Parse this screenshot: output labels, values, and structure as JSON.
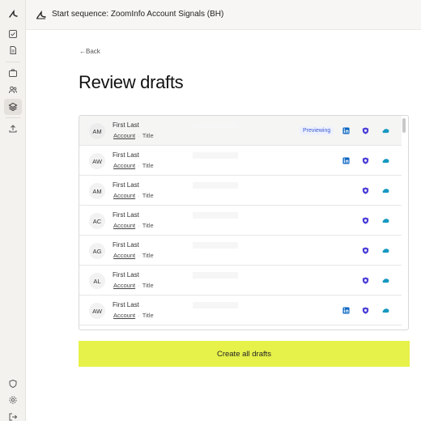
{
  "app": {
    "title": "Start sequence: ZoomInfo Account Signals (BH)"
  },
  "sidebar": {
    "items": [
      {
        "icon": "checkbox-icon"
      },
      {
        "icon": "document-icon"
      },
      {
        "icon": "briefcase-icon"
      },
      {
        "icon": "users-icon"
      },
      {
        "icon": "layers-icon",
        "active": true
      },
      {
        "icon": "upload-icon"
      }
    ],
    "bottom_items": [
      {
        "icon": "shield-icon"
      },
      {
        "icon": "gear-icon"
      },
      {
        "icon": "logout-icon"
      }
    ]
  },
  "nav": {
    "back_label": "←Back"
  },
  "page": {
    "title": "Review drafts"
  },
  "drafts": [
    {
      "initials": "AM",
      "name": "First Last",
      "account": "Account",
      "title": "Title",
      "status": "Previewing",
      "linkedin": true,
      "shield": true,
      "salesforce": true
    },
    {
      "initials": "AW",
      "name": "First Last",
      "account": "Account",
      "title": "Title",
      "linkedin": true,
      "shield": true,
      "salesforce": true
    },
    {
      "initials": "AM",
      "name": "First Last",
      "account": "Account",
      "title": "Title",
      "linkedin": false,
      "shield": true,
      "salesforce": true
    },
    {
      "initials": "AC",
      "name": "First Last",
      "account": "Account",
      "title": "Title",
      "linkedin": false,
      "shield": true,
      "salesforce": true
    },
    {
      "initials": "AG",
      "name": "First Last",
      "account": "Account",
      "title": "Title",
      "linkedin": false,
      "shield": true,
      "salesforce": true
    },
    {
      "initials": "AL",
      "name": "First Last",
      "account": "Account",
      "title": "Title",
      "linkedin": false,
      "shield": true,
      "salesforce": true
    },
    {
      "initials": "AW",
      "name": "First Last",
      "account": "Account",
      "title": "Title",
      "linkedin": true,
      "shield": true,
      "salesforce": true
    }
  ],
  "actions": {
    "create_all_label": "Create all drafts"
  },
  "colors": {
    "cta_bg": "#e6f14a",
    "linkedin": "#0a66c2",
    "shield": "#4b3fd8",
    "salesforce": "#1798c1",
    "preview_badge": "#3a5bd9"
  }
}
